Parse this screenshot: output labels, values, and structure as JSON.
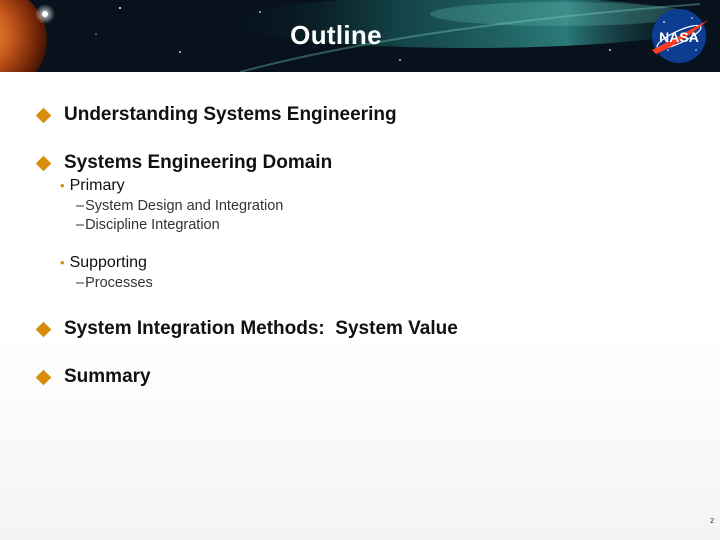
{
  "slide": {
    "title": "Outline",
    "page_number": "2",
    "logo_text": "NASA"
  },
  "colors": {
    "bullet_accent": "#d88c0c",
    "header_background": "#07121c",
    "nasa_blue": "#0b3d91",
    "nasa_red": "#fc3d21"
  },
  "icons": {
    "level1_bullet": "orange-diamond-icon",
    "level2_bullet": "orange-dot-icon",
    "level3_bullet": "dash"
  },
  "outline": {
    "item1": {
      "text": "Understanding Systems Engineering"
    },
    "item2": {
      "text": "Systems Engineering Domain",
      "sub1": {
        "text": "Primary",
        "marker": "•",
        "children": [
          "System Design and Integration",
          "Discipline Integration"
        ],
        "dash": "–"
      },
      "sub2": {
        "text": "Supporting",
        "marker": "•",
        "children": [
          "Processes"
        ],
        "dash": "–"
      }
    },
    "item3": {
      "text": "System Integration Methods:  System Value"
    },
    "item4": {
      "text": "Summary"
    }
  }
}
